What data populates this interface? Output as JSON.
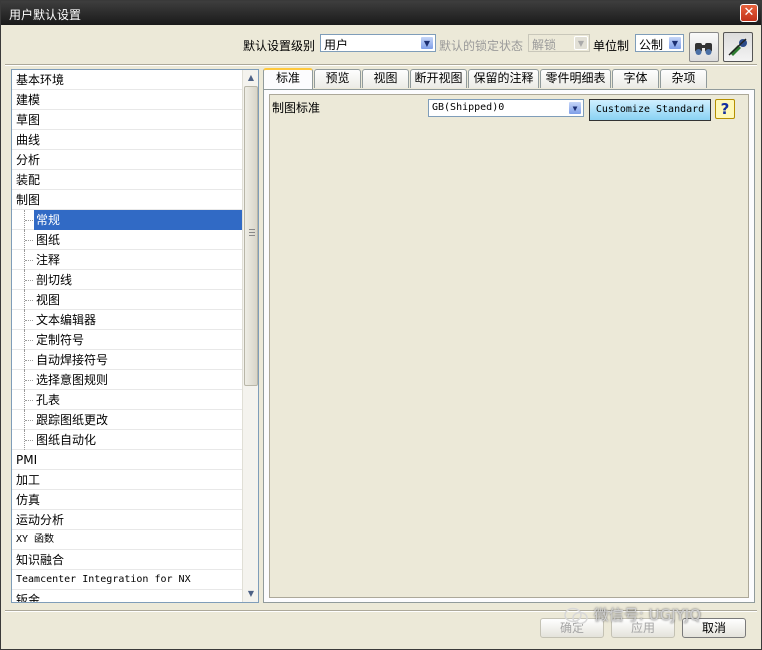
{
  "window": {
    "title": "用户默认设置",
    "close_icon": "close-icon"
  },
  "toolbar": {
    "level_label": "默认设置级别",
    "level_value": "用户",
    "lock_label": "默认的锁定状态",
    "lock_value": "解锁",
    "unit_label": "单位制",
    "unit_value": "公制",
    "search_icon": "binoculars-icon",
    "manage_icon": "manage-icon"
  },
  "tree": {
    "items": [
      {
        "label": "基本环境",
        "level": 0
      },
      {
        "label": "建模",
        "level": 0
      },
      {
        "label": "草图",
        "level": 0
      },
      {
        "label": "曲线",
        "level": 0
      },
      {
        "label": "分析",
        "level": 0
      },
      {
        "label": "装配",
        "level": 0
      },
      {
        "label": "制图",
        "level": 0
      },
      {
        "label": "常规",
        "level": 1,
        "selected": true
      },
      {
        "label": "图纸",
        "level": 1
      },
      {
        "label": "注释",
        "level": 1
      },
      {
        "label": "剖切线",
        "level": 1
      },
      {
        "label": "视图",
        "level": 1
      },
      {
        "label": "文本编辑器",
        "level": 1
      },
      {
        "label": "定制符号",
        "level": 1
      },
      {
        "label": "自动焊接符号",
        "level": 1
      },
      {
        "label": "选择意图规则",
        "level": 1
      },
      {
        "label": "孔表",
        "level": 1
      },
      {
        "label": "跟踪图纸更改",
        "level": 1
      },
      {
        "label": "图纸自动化",
        "level": 1
      },
      {
        "label": "PMI",
        "level": 0
      },
      {
        "label": "加工",
        "level": 0
      },
      {
        "label": "仿真",
        "level": 0
      },
      {
        "label": "运动分析",
        "level": 0
      },
      {
        "label": "XY 函数",
        "level": 0
      },
      {
        "label": "知识融合",
        "level": 0
      },
      {
        "label": "Teamcenter Integration for NX",
        "level": 0
      },
      {
        "label": "钣金",
        "level": 0
      }
    ]
  },
  "tabs": [
    "标准",
    "预览",
    "视图",
    "断开视图",
    "保留的注释",
    "零件明细表",
    "字体",
    "杂项"
  ],
  "active_tab": "标准",
  "panel": {
    "standard_label": "制图标准",
    "standard_value": "GB(Shipped)0",
    "customize_button": "Customize Standard",
    "help_icon": "help-icon",
    "help_glyph": "?"
  },
  "buttons": {
    "ok": "确定",
    "apply": "应用",
    "cancel": "取消"
  },
  "watermark": "微信号: UGJYJQ",
  "colors": {
    "selection": "#316ac5",
    "customize_button": "#8ad2f3",
    "titlebar": "#1a1a1a"
  }
}
